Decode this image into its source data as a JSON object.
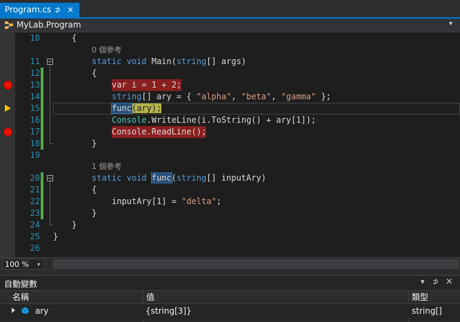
{
  "document_tab": {
    "title": "Program.cs",
    "pin": "⊅",
    "close": "×"
  },
  "navigation": {
    "class_label": "MyLab.Program",
    "dropdown": "▾"
  },
  "editor": {
    "line_numbers": [
      "10",
      "11",
      "12",
      "13",
      "14",
      "15",
      "16",
      "17",
      "18",
      "19",
      "20",
      "21",
      "22",
      "23",
      "24",
      "25",
      "26"
    ],
    "ref_main": "0 個參考",
    "ref_func": "1 個參考",
    "lines": {
      "l10": "{",
      "l11_static": "static",
      "l11_void": "void",
      "l11_rest1": " Main(",
      "l11_string": "string",
      "l11_rest2": "[] args)",
      "l12": "{",
      "l13": "var i = 1 + 2;",
      "l14_string": "string",
      "l14_rest1": "[] ary = { ",
      "l14_s1": "\"alpha\"",
      "l14_c1": ", ",
      "l14_s2": "\"beta\"",
      "l14_c2": ", ",
      "l14_s3": "\"gamma\"",
      "l14_rest2": " };",
      "l15_func": "func",
      "l15_rest": "(ary);",
      "l16_console": "Console",
      "l16_rest": ".WriteLine(i.ToString() + ary[1]);",
      "l17": "Console.ReadLine();",
      "l18": "}",
      "l20_static": "static",
      "l20_void": "void",
      "l20_func": "func",
      "l20_paren": "(",
      "l20_string": "string",
      "l20_rest": "[] inputAry)",
      "l21": "{",
      "l22_a": "inputAry[1] = ",
      "l22_s": "\"delta\"",
      "l22_b": ";",
      "l23": "}",
      "l24": "}",
      "l25": "}"
    }
  },
  "zoom": {
    "value": "100 %",
    "dropdown": "▾"
  },
  "autos_window": {
    "title": "自動變數",
    "buttons": {
      "dropdown": "▾",
      "pin": "⊅",
      "close": "×"
    },
    "columns": [
      "名稱",
      "值",
      "類型"
    ],
    "rows": [
      {
        "name": "ary",
        "value": "{string[3]}",
        "type": "string[]"
      }
    ]
  },
  "colors": {
    "accent": "#007acc",
    "breakpoint": "#e51400",
    "current_statement": "#ffcc00",
    "changes_saved": "#57a64a"
  }
}
